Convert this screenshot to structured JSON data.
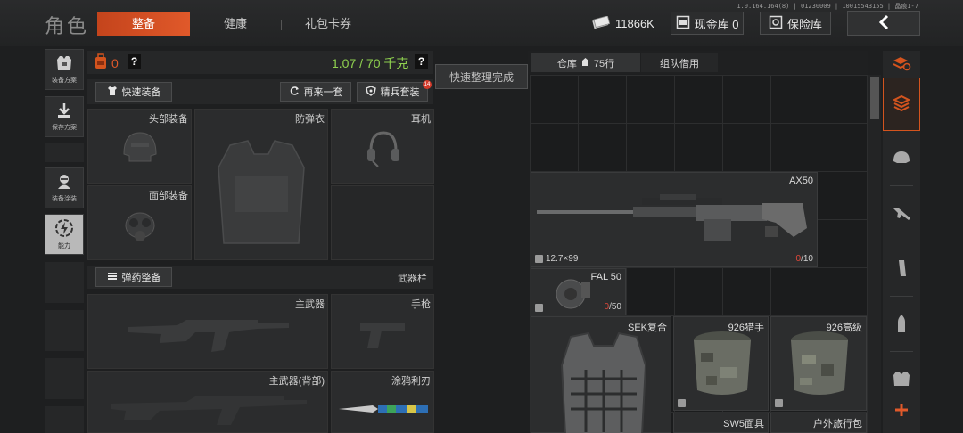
{
  "header": {
    "title": "角色",
    "version": "1.0.164.164(8) | 01230009 | 10015543155 | 晶痕1-7",
    "tabs": [
      {
        "label": "整备",
        "active": true
      },
      {
        "label": "健康",
        "active": false
      },
      {
        "label": "礼包卡券",
        "active": false
      }
    ],
    "currency": "11866K",
    "cash_vault_label": "现金库 0",
    "safe_label": "保险库"
  },
  "sidebar": {
    "items": [
      {
        "label": "装备方案",
        "icon": "vest-plan-icon"
      },
      {
        "label": "保存方案",
        "icon": "save-download-icon"
      },
      {
        "label": "装备涂装",
        "icon": "skin-paint-icon"
      },
      {
        "label": "能力",
        "icon": "ability-bolt-icon",
        "active": true
      }
    ]
  },
  "loadout": {
    "backpack_count": "0",
    "help": "?",
    "weight": "1.07 / 70 千克",
    "weight_help": "?",
    "quick_equip": "快速装备",
    "again": "再来一套",
    "elite": "精兵套装",
    "elite_badge": "14",
    "slots": {
      "head": "头部装备",
      "armor": "防弹衣",
      "headset": "耳机",
      "face": "面部装备"
    },
    "ammo_btn": "弹药整备",
    "weapons_label": "武器栏",
    "weapon_slots": {
      "primary": "主武器",
      "pistol": "手枪",
      "primary_back": "主武器(背部)",
      "melee": "涂鸦利刃"
    }
  },
  "tooltip": "快速整理完成",
  "warehouse": {
    "tab_storage": "仓库",
    "tab_rows": "75行",
    "tab_team": "组队借用",
    "items": [
      {
        "name": "AX50",
        "caliber": "12.7×99",
        "ammo_current": "0",
        "ammo_max": "/10"
      },
      {
        "name": "FAL 50",
        "ammo_current": "0",
        "ammo_max": "/50"
      },
      {
        "name": "SEK复合"
      },
      {
        "name": "926猎手"
      },
      {
        "name": "926高级"
      },
      {
        "name": "SW5面具"
      },
      {
        "name": "户外旅行包"
      }
    ]
  },
  "rail": {
    "icons": [
      "stack-refresh-icon",
      "cube-stack-icon",
      "helmet-icon",
      "rifle-icon",
      "magazine-icon",
      "bullet-icon",
      "vest-icon",
      "plus-icon"
    ]
  },
  "colors": {
    "accent": "#e0592a",
    "weight_green": "#8fd14f",
    "ammo_red": "#e0483a"
  }
}
